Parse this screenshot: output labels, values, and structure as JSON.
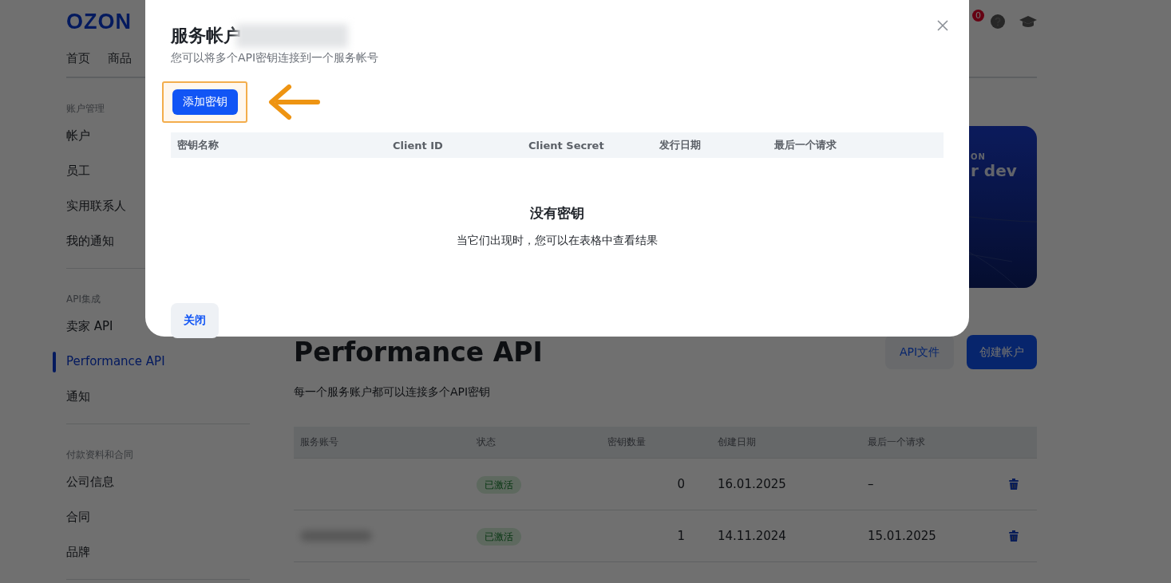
{
  "header": {
    "logo": "OZON",
    "nav": [
      {
        "label": "首页",
        "selected": false
      },
      {
        "label": "商品",
        "selected": false
      }
    ],
    "notification_badge": "0"
  },
  "sidebar": {
    "sections": [
      {
        "title": "账户管理",
        "items": [
          {
            "label": "帐户",
            "selected": false
          },
          {
            "label": "员工",
            "selected": false
          },
          {
            "label": "实用联系人",
            "selected": false
          },
          {
            "label": "我的通知",
            "selected": false
          }
        ]
      },
      {
        "title": "API集成",
        "items": [
          {
            "label": "卖家 API",
            "selected": false
          },
          {
            "label": "Performance API",
            "selected": true
          },
          {
            "label": "通知",
            "selected": false
          }
        ]
      },
      {
        "title": "付款资料和合同",
        "items": [
          {
            "label": "公司信息",
            "selected": false
          },
          {
            "label": "合同",
            "selected": false
          },
          {
            "label": "品牌",
            "selected": false
          }
        ]
      }
    ]
  },
  "banner": {
    "brand": "ON",
    "title": "r dev"
  },
  "main": {
    "title": "Performance API",
    "buttons": [
      {
        "label": "API文件",
        "kind": "secondary"
      },
      {
        "label": "创建帐户",
        "kind": "primary"
      }
    ],
    "description": "每一个服务账户都可以连接多个API密钥",
    "table": {
      "columns": [
        "服务账号",
        "状态",
        "密钥数量",
        "创建日期",
        "最后一个请求"
      ],
      "rows": [
        {
          "account_redacted": false,
          "status": "已激活",
          "key_count": "0",
          "created": "16.01.2025",
          "last_request": "–"
        },
        {
          "account_redacted": true,
          "status": "已激活",
          "key_count": "1",
          "created": "14.11.2024",
          "last_request": "15.01.2025"
        }
      ]
    }
  },
  "modal": {
    "title": "服务帐户",
    "title_redacted": true,
    "subtitle": "您可以将多个API密钥连接到一个服务帐号",
    "add_button": {
      "label": "添加密钥",
      "highlighted": true
    },
    "table": {
      "columns": [
        "密钥名称",
        "Client ID",
        "Client Secret",
        "发行日期",
        "最后一个请求"
      ]
    },
    "empty_title": "没有密钥",
    "empty_text": "当它们出现时，您可以在表格中查看结果",
    "close_button": "关闭"
  }
}
